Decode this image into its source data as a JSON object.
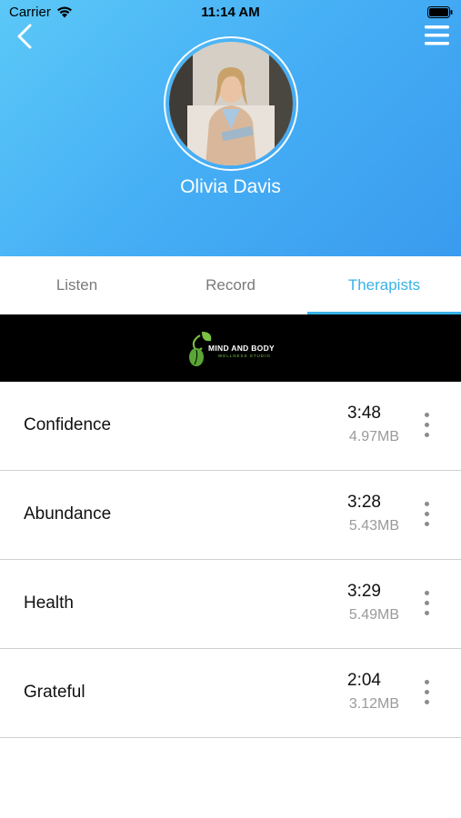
{
  "status_bar": {
    "carrier": "Carrier",
    "time": "11:14 AM"
  },
  "profile": {
    "name": "Olivia Davis"
  },
  "tabs": [
    {
      "label": "Listen",
      "active": false
    },
    {
      "label": "Record",
      "active": false
    },
    {
      "label": "Therapists",
      "active": true
    }
  ],
  "banner": {
    "title": "MIND AND BODY",
    "subtitle": "WELLNESS STUDIO"
  },
  "recordings": [
    {
      "title": "Confidence",
      "duration": "3:48",
      "size": "4.97MB"
    },
    {
      "title": "Abundance",
      "duration": "3:28",
      "size": "5.43MB"
    },
    {
      "title": "Health",
      "duration": "3:29",
      "size": "5.49MB"
    },
    {
      "title": "Grateful",
      "duration": "2:04",
      "size": "3.12MB"
    }
  ],
  "colors": {
    "header_start": "#5bc8f7",
    "header_end": "#3a9bee",
    "accent": "#38b2e6",
    "banner": "#000000",
    "logo_green": "#7dc142"
  },
  "icons": {
    "back": "chevron-left-icon",
    "menu": "hamburger-menu-icon",
    "more": "vertical-ellipsis-icon",
    "wifi": "wifi-icon",
    "battery": "battery-icon"
  }
}
